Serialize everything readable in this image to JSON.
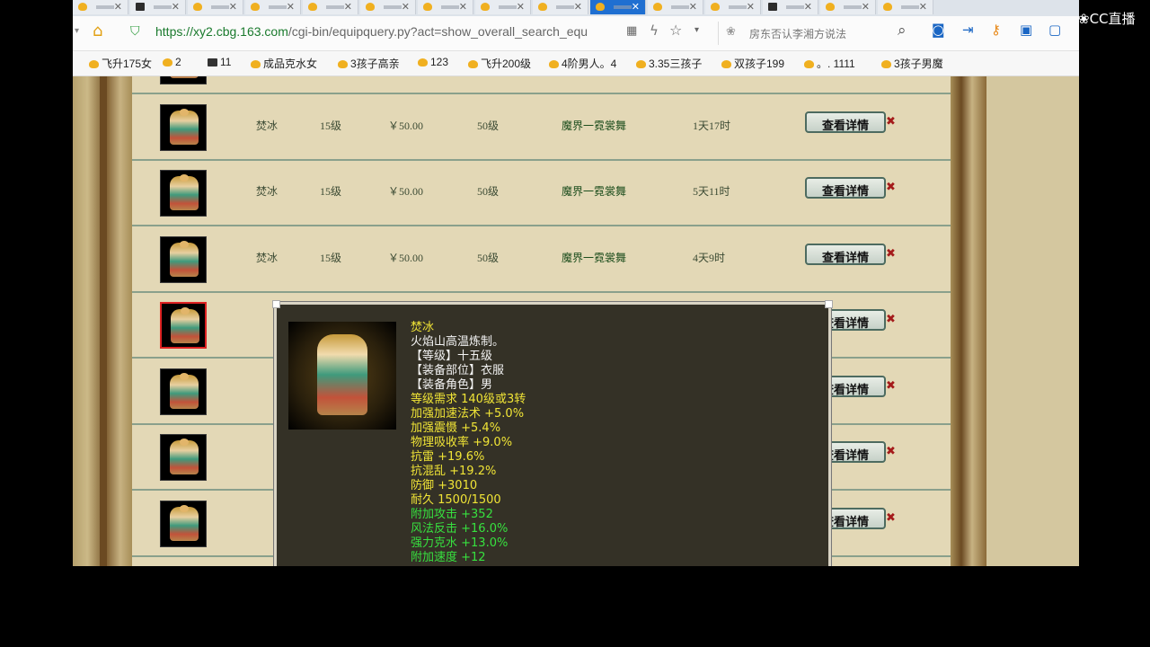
{
  "browser": {
    "url_host": "https://xy2.cbg.163.com",
    "url_path": "/cgi-bin/equipquery.py?act=show_overall_search_equ",
    "search_placeholder": "房东否认李湘方说法"
  },
  "bookmarks": [
    {
      "label": "飞升175女",
      "icon": "star-fav-icon"
    },
    {
      "label": "2",
      "icon": "star-fav-icon"
    },
    {
      "label": "11",
      "icon": "dark-fav-icon"
    },
    {
      "label": "成品克水女",
      "icon": "star-fav-icon"
    },
    {
      "label": "3孩子高亲",
      "icon": "star-fav-icon"
    },
    {
      "label": "123",
      "icon": "star-fav-icon"
    },
    {
      "label": "飞升200级",
      "icon": "star-fav-icon"
    },
    {
      "label": "4阶男人。4",
      "icon": "star-fav-icon"
    },
    {
      "label": "3.35三孩子",
      "icon": "star-fav-icon"
    },
    {
      "label": "双孩子199",
      "icon": "star-fav-icon"
    },
    {
      "label": "。. 1111",
      "icon": "star-fav-icon"
    },
    {
      "label": "3孩子男魔",
      "icon": "star-fav-icon"
    }
  ],
  "rows": [
    {
      "name": "焚冰",
      "level": "15级",
      "price": "￥50.00",
      "req": "50级",
      "seller": "魔界一霓裳舞",
      "time": "1天17时"
    },
    {
      "name": "焚冰",
      "level": "15级",
      "price": "￥50.00",
      "req": "50级",
      "seller": "魔界一霓裳舞",
      "time": "5天11时"
    },
    {
      "name": "焚冰",
      "level": "15级",
      "price": "￥50.00",
      "req": "50级",
      "seller": "魔界一霓裳舞",
      "time": "4天9时"
    },
    {
      "name": "",
      "level": "",
      "price": "",
      "req": "",
      "seller": "",
      "time": ""
    },
    {
      "name": "",
      "level": "",
      "price": "",
      "req": "",
      "seller": "",
      "time": ""
    },
    {
      "name": "",
      "level": "",
      "price": "",
      "req": "",
      "seller": "",
      "time": ""
    },
    {
      "name": "",
      "level": "",
      "price": "",
      "req": "",
      "seller": "",
      "time": ""
    }
  ],
  "detail_label": "查看详情",
  "tooltip": {
    "lines": [
      {
        "text": "焚冰",
        "color": "yellow"
      },
      {
        "text": "火焰山高温炼制。",
        "color": "white"
      },
      {
        "text": "【等级】十五级",
        "color": "white"
      },
      {
        "text": "【装备部位】衣服",
        "color": "white"
      },
      {
        "text": "【装备角色】男",
        "color": "white"
      },
      {
        "text": "等级需求 140级或3转",
        "color": "yellow"
      },
      {
        "text": "加强加速法术 +5.0%",
        "color": "yellow"
      },
      {
        "text": "加强震慑 +5.4%",
        "color": "yellow"
      },
      {
        "text": "物理吸收率 +9.0%",
        "color": "yellow"
      },
      {
        "text": "抗雷 +19.6%",
        "color": "yellow"
      },
      {
        "text": "抗混乱 +19.2%",
        "color": "yellow"
      },
      {
        "text": "防御 +3010",
        "color": "yellow"
      },
      {
        "text": "耐久 1500/1500",
        "color": "yellow"
      },
      {
        "text": "附加攻击 +352",
        "color": "green"
      },
      {
        "text": "风法反击 +16.0%",
        "color": "green"
      },
      {
        "text": "强力克水 +13.0%",
        "color": "green"
      },
      {
        "text": "附加速度 +12",
        "color": "green"
      }
    ]
  },
  "overlay_logo": "CC直播",
  "colors": {
    "yellow": "#f0e436",
    "white": "#f2f2f2",
    "green": "#37e13f",
    "tab_active": "#1f6fd1"
  }
}
